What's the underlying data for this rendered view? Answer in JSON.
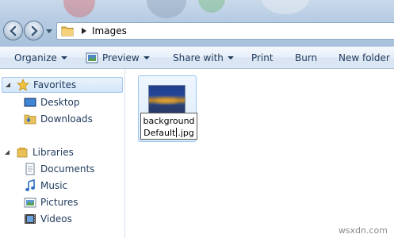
{
  "address": {
    "path_segment": "Images"
  },
  "toolbar": {
    "organize": "Organize",
    "preview": "Preview",
    "share_with": "Share with",
    "print": "Print",
    "burn": "Burn",
    "new_folder": "New folder"
  },
  "sidebar": {
    "favorites": {
      "label": "Favorites",
      "items": [
        "Desktop",
        "Downloads"
      ]
    },
    "libraries": {
      "label": "Libraries",
      "items": [
        "Documents",
        "Music",
        "Pictures",
        "Videos"
      ]
    }
  },
  "file": {
    "name_line1": "background",
    "name_line2_before": "Default",
    "name_line2_after": ".jpg"
  },
  "watermark": "wsxdn.com",
  "colors": {
    "selection": "#d3e6fa",
    "text": "#1e395b",
    "accent": "#99c6f1"
  }
}
